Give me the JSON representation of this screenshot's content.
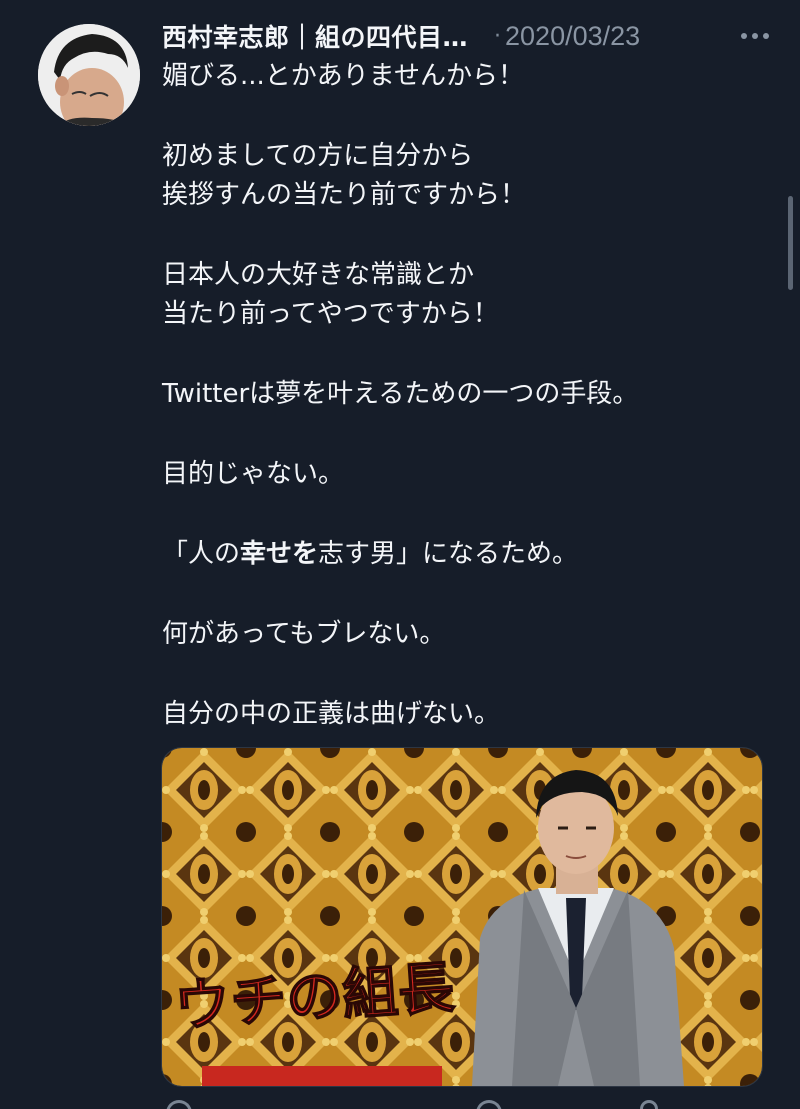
{
  "tweet": {
    "display_name": "西村幸志郎｜組の四代目…",
    "separator": "·",
    "date": "2020/03/23",
    "body": {
      "line_1": "媚びる...とかありませんから！",
      "line_2": "初めましての方に自分から",
      "line_3": "挨拶すんの当たり前ですから！",
      "line_4": "日本人の大好きな常識とか",
      "line_5": "当たり前ってやつですから！",
      "line_6": "Twitterは夢を叶えるための一つの手段。",
      "line_7": "目的じゃない。",
      "line_8_pre": "「人の",
      "line_8_bold_1": "幸せ",
      "line_8_bold_2": "を",
      "line_8_post": "志す男」になるため。",
      "line_9": "何があってもブレない。",
      "line_10": "自分の中の正義は曲げない。"
    },
    "media": {
      "overlay_text": "ウチの組長"
    },
    "icons": {
      "more": "more-icon",
      "reply": "reply-icon",
      "like": "like-icon",
      "share": "share-icon"
    }
  }
}
